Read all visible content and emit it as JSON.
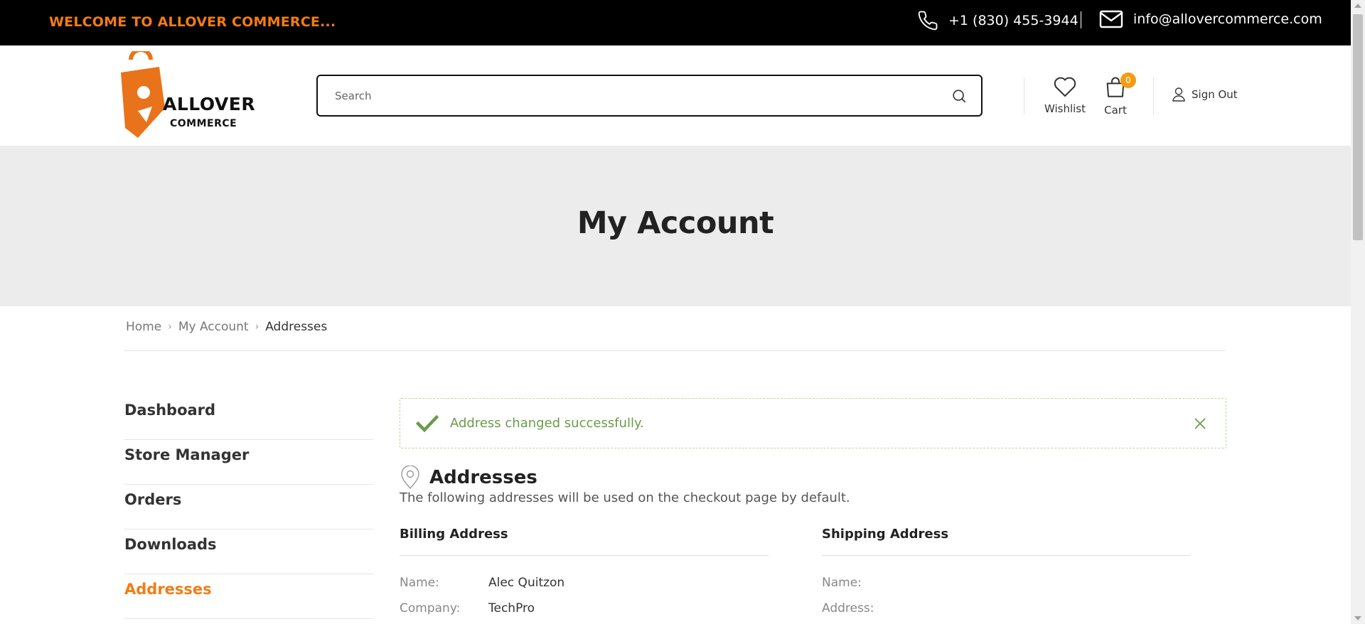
{
  "topbar": {
    "welcome": "WELCOME TO ALLOVER COMMERCE...",
    "phone": "+1 (830) 455-3944",
    "email": "info@allovercommerce.com"
  },
  "header": {
    "logo": {
      "word1": "ALLOVER",
      "word2": "COMMERCE"
    },
    "search_placeholder": "Search",
    "wishlist_label": "Wishlist",
    "cart_label": "Cart",
    "cart_count": "0",
    "signout_label": "Sign Out"
  },
  "hero": {
    "title": "My Account"
  },
  "breadcrumb": {
    "home": "Home",
    "account": "My Account",
    "current": "Addresses"
  },
  "sidebar": {
    "items": [
      {
        "label": "Dashboard"
      },
      {
        "label": "Store Manager"
      },
      {
        "label": "Orders"
      },
      {
        "label": "Downloads"
      },
      {
        "label": "Addresses"
      }
    ]
  },
  "alert": {
    "message": "Address changed successfully."
  },
  "addresses": {
    "title": "Addresses",
    "description": "The following addresses will be used on the checkout page by default.",
    "billing": {
      "title": "Billing Address",
      "name_label": "Name:",
      "name_value": "Alec Quitzon",
      "company_label": "Company:",
      "company_value": "TechPro"
    },
    "shipping": {
      "title": "Shipping Address",
      "name_label": "Name:",
      "address_label": "Address:"
    }
  },
  "colors": {
    "accent": "#f27c15",
    "topbar_bg": "#000000",
    "hero_bg": "#ececec",
    "success": "#6a9b4a"
  }
}
